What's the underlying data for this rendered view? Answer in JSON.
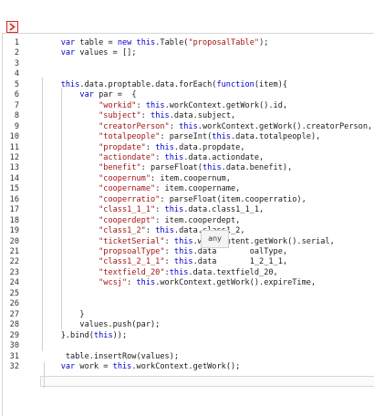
{
  "toolbar": {
    "button_icon": "chevron-right-icon",
    "accent": "#c9302c"
  },
  "tooltip": {
    "text": "any"
  },
  "lines": [
    {
      "n": "1",
      "t": [
        [
          "    ",
          "pl"
        ],
        [
          "var",
          "kw"
        ],
        [
          " table = ",
          "pl"
        ],
        [
          "new",
          "kw"
        ],
        [
          " ",
          "pl"
        ],
        [
          "this",
          "kw"
        ],
        [
          ".Table(",
          "pl"
        ],
        [
          "\"proposalTable\"",
          "str"
        ],
        [
          ");",
          "pl"
        ]
      ]
    },
    {
      "n": "2",
      "t": [
        [
          "    ",
          "pl"
        ],
        [
          "var",
          "kw"
        ],
        [
          " values = [];",
          "pl"
        ]
      ]
    },
    {
      "n": "3",
      "t": []
    },
    {
      "n": "4",
      "t": []
    },
    {
      "n": "5",
      "t": [
        [
          "    ",
          "pl"
        ],
        [
          "this",
          "kw"
        ],
        [
          ".data.proptable.data.forEach(",
          "pl"
        ],
        [
          "function",
          "kw"
        ],
        [
          "(item){",
          "pl"
        ]
      ]
    },
    {
      "n": "6",
      "t": [
        [
          "        ",
          "pl"
        ],
        [
          "var",
          "kw"
        ],
        [
          " par =  {",
          "pl"
        ]
      ]
    },
    {
      "n": "7",
      "t": [
        [
          "            ",
          "pl"
        ],
        [
          "\"workid\"",
          "str"
        ],
        [
          ": ",
          "pl"
        ],
        [
          "this",
          "kw"
        ],
        [
          ".workContext.getWork().id,",
          "pl"
        ]
      ]
    },
    {
      "n": "8",
      "t": [
        [
          "            ",
          "pl"
        ],
        [
          "\"subject\"",
          "str"
        ],
        [
          ": ",
          "pl"
        ],
        [
          "this",
          "kw"
        ],
        [
          ".data.subject,",
          "pl"
        ]
      ]
    },
    {
      "n": "9",
      "t": [
        [
          "            ",
          "pl"
        ],
        [
          "\"creatorPerson\"",
          "str"
        ],
        [
          ": ",
          "pl"
        ],
        [
          "this",
          "kw"
        ],
        [
          ".workContext.getWork().creatorPerson,",
          "pl"
        ]
      ]
    },
    {
      "n": "10",
      "t": [
        [
          "            ",
          "pl"
        ],
        [
          "\"totalpeople\"",
          "str"
        ],
        [
          ": parseInt(",
          "pl"
        ],
        [
          "this",
          "kw"
        ],
        [
          ".data.totalpeople),",
          "pl"
        ]
      ]
    },
    {
      "n": "11",
      "t": [
        [
          "            ",
          "pl"
        ],
        [
          "\"propdate\"",
          "str"
        ],
        [
          ": ",
          "pl"
        ],
        [
          "this",
          "kw"
        ],
        [
          ".data.propdate,",
          "pl"
        ]
      ]
    },
    {
      "n": "12",
      "t": [
        [
          "            ",
          "pl"
        ],
        [
          "\"actiondate\"",
          "str"
        ],
        [
          ": ",
          "pl"
        ],
        [
          "this",
          "kw"
        ],
        [
          ".data.actiondate,",
          "pl"
        ]
      ]
    },
    {
      "n": "13",
      "t": [
        [
          "            ",
          "pl"
        ],
        [
          "\"benefit\"",
          "str"
        ],
        [
          ": parseFloat(",
          "pl"
        ],
        [
          "this",
          "kw"
        ],
        [
          ".data.benefit),",
          "pl"
        ]
      ]
    },
    {
      "n": "14",
      "t": [
        [
          "            ",
          "pl"
        ],
        [
          "\"coopernum\"",
          "str"
        ],
        [
          ": item.coopernum,",
          "pl"
        ]
      ]
    },
    {
      "n": "15",
      "t": [
        [
          "            ",
          "pl"
        ],
        [
          "\"coopername\"",
          "str"
        ],
        [
          ": item.coopername,",
          "pl"
        ]
      ]
    },
    {
      "n": "16",
      "t": [
        [
          "            ",
          "pl"
        ],
        [
          "\"cooperratio\"",
          "str"
        ],
        [
          ": parseFloat(item.cooperratio),",
          "pl"
        ]
      ]
    },
    {
      "n": "17",
      "t": [
        [
          "            ",
          "pl"
        ],
        [
          "\"class1_1_1\"",
          "str"
        ],
        [
          ": ",
          "pl"
        ],
        [
          "this",
          "kw"
        ],
        [
          ".data.class1_1_1,",
          "pl"
        ]
      ]
    },
    {
      "n": "18",
      "t": [
        [
          "            ",
          "pl"
        ],
        [
          "\"cooperdept\"",
          "str"
        ],
        [
          ": item.cooperdept,",
          "pl"
        ]
      ]
    },
    {
      "n": "19",
      "t": [
        [
          "            ",
          "pl"
        ],
        [
          "\"class1_2\"",
          "str"
        ],
        [
          ": ",
          "pl"
        ],
        [
          "this",
          "kw"
        ],
        [
          ".data.class1_2,",
          "pl"
        ]
      ]
    },
    {
      "n": "20",
      "t": [
        [
          "            ",
          "pl"
        ],
        [
          "\"ticketSerial\"",
          "str"
        ],
        [
          ": ",
          "pl"
        ],
        [
          "this",
          "kw"
        ],
        [
          ".workContent.getWork().serial,",
          "pl"
        ]
      ]
    },
    {
      "n": "21",
      "t": [
        [
          "            ",
          "pl"
        ],
        [
          "\"propsoalType\"",
          "str"
        ],
        [
          ": ",
          "pl"
        ],
        [
          "this",
          "kw"
        ],
        [
          ".data",
          "pl"
        ],
        [
          "       ",
          "pl"
        ],
        [
          "oalType,",
          "pl"
        ]
      ]
    },
    {
      "n": "22",
      "t": [
        [
          "            ",
          "pl"
        ],
        [
          "\"class1_2_1_1\"",
          "str"
        ],
        [
          ": ",
          "pl"
        ],
        [
          "this",
          "kw"
        ],
        [
          ".data",
          "pl"
        ],
        [
          "       ",
          "pl"
        ],
        [
          "1_2_1_1,",
          "pl"
        ]
      ]
    },
    {
      "n": "23",
      "t": [
        [
          "            ",
          "pl"
        ],
        [
          "\"textfield_20\"",
          "str"
        ],
        [
          ":",
          "pl"
        ],
        [
          "this",
          "kw"
        ],
        [
          ".data.textfield_20,",
          "pl"
        ]
      ]
    },
    {
      "n": "24",
      "t": [
        [
          "            ",
          "pl"
        ],
        [
          "\"wcsj\"",
          "str"
        ],
        [
          ": ",
          "pl"
        ],
        [
          "this",
          "kw"
        ],
        [
          ".workContext.getWork().expireTime,",
          "pl"
        ]
      ]
    },
    {
      "n": "25",
      "t": []
    },
    {
      "n": "26",
      "t": []
    },
    {
      "n": "27",
      "t": [
        [
          "        }",
          "pl"
        ]
      ]
    },
    {
      "n": "28",
      "t": [
        [
          "        values.push(par);",
          "pl"
        ]
      ]
    },
    {
      "n": "29",
      "t": [
        [
          "    }.bind(",
          "pl"
        ],
        [
          "this",
          "kw"
        ],
        [
          "));",
          "pl"
        ]
      ]
    },
    {
      "n": "30",
      "t": []
    },
    {
      "n": "31",
      "t": [
        [
          "     table.insertRow(values);",
          "pl"
        ]
      ]
    },
    {
      "n": "32",
      "t": [
        [
          "    ",
          "pl"
        ],
        [
          "var",
          "kw"
        ],
        [
          " work = ",
          "pl"
        ],
        [
          "this",
          "kw"
        ],
        [
          ".workContext.getWork();",
          "pl"
        ]
      ]
    }
  ]
}
